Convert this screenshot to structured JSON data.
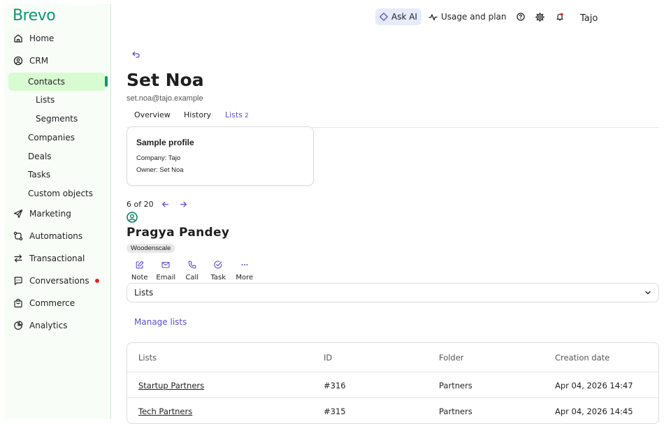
{
  "brand": {
    "logo_text": "Brevo",
    "color": "#0b996e"
  },
  "sidebar": {
    "items": [
      {
        "label": "Home",
        "icon": "home-icon"
      },
      {
        "label": "CRM",
        "icon": "user-circle-icon"
      },
      {
        "label": "Contacts"
      },
      {
        "label": "Lists"
      },
      {
        "label": "Segments"
      },
      {
        "label": "Companies"
      },
      {
        "label": "Deals"
      },
      {
        "label": "Tasks"
      },
      {
        "label": "Custom objects"
      },
      {
        "label": "Marketing",
        "icon": "send-icon"
      },
      {
        "label": "Automations",
        "icon": "automation-icon"
      },
      {
        "label": "Transactional",
        "icon": "transfer-icon"
      },
      {
        "label": "Conversations",
        "icon": "chat-icon"
      },
      {
        "label": "Commerce",
        "icon": "bag-icon"
      },
      {
        "label": "Analytics",
        "icon": "pie-chart-icon"
      }
    ]
  },
  "topbar": {
    "ask_ai": "Ask AI",
    "usage": "Usage and plan",
    "account": "Tajo"
  },
  "contact": {
    "name": "Set Noa",
    "email": "set.noa@tajo.example"
  },
  "tabs": [
    {
      "label": "Overview"
    },
    {
      "label": "History"
    },
    {
      "label": "Lists",
      "count": "2"
    }
  ],
  "profile_card": {
    "title": "Sample profile",
    "company": "Company: Tajo",
    "owner": "Owner: Set Noa"
  },
  "pager": {
    "text": "6 of 20"
  },
  "person": {
    "name": "Pragya Pandey",
    "tag": "Woodenscale"
  },
  "actions": [
    {
      "label": "Note",
      "icon": "edit-icon"
    },
    {
      "label": "Email",
      "icon": "mail-icon"
    },
    {
      "label": "Call",
      "icon": "phone-icon"
    },
    {
      "label": "Task",
      "icon": "check-circle-icon"
    },
    {
      "label": "More",
      "icon": "more-icon"
    }
  ],
  "lists_section": {
    "label": "Lists",
    "manage_link": "Manage lists"
  },
  "table": {
    "headers": [
      "Lists",
      "ID",
      "Folder",
      "Creation date"
    ],
    "rows": [
      [
        "Startup Partners",
        "#316",
        "Partners",
        "Apr 04, 2026 14:47"
      ],
      [
        "Tech Partners",
        "#315",
        "Partners",
        "Apr 04, 2026 14:45"
      ]
    ]
  },
  "colors": {
    "accent": "#5a4fcf",
    "active_nav": "#d9fbd1",
    "alert": "#d52a2a"
  }
}
